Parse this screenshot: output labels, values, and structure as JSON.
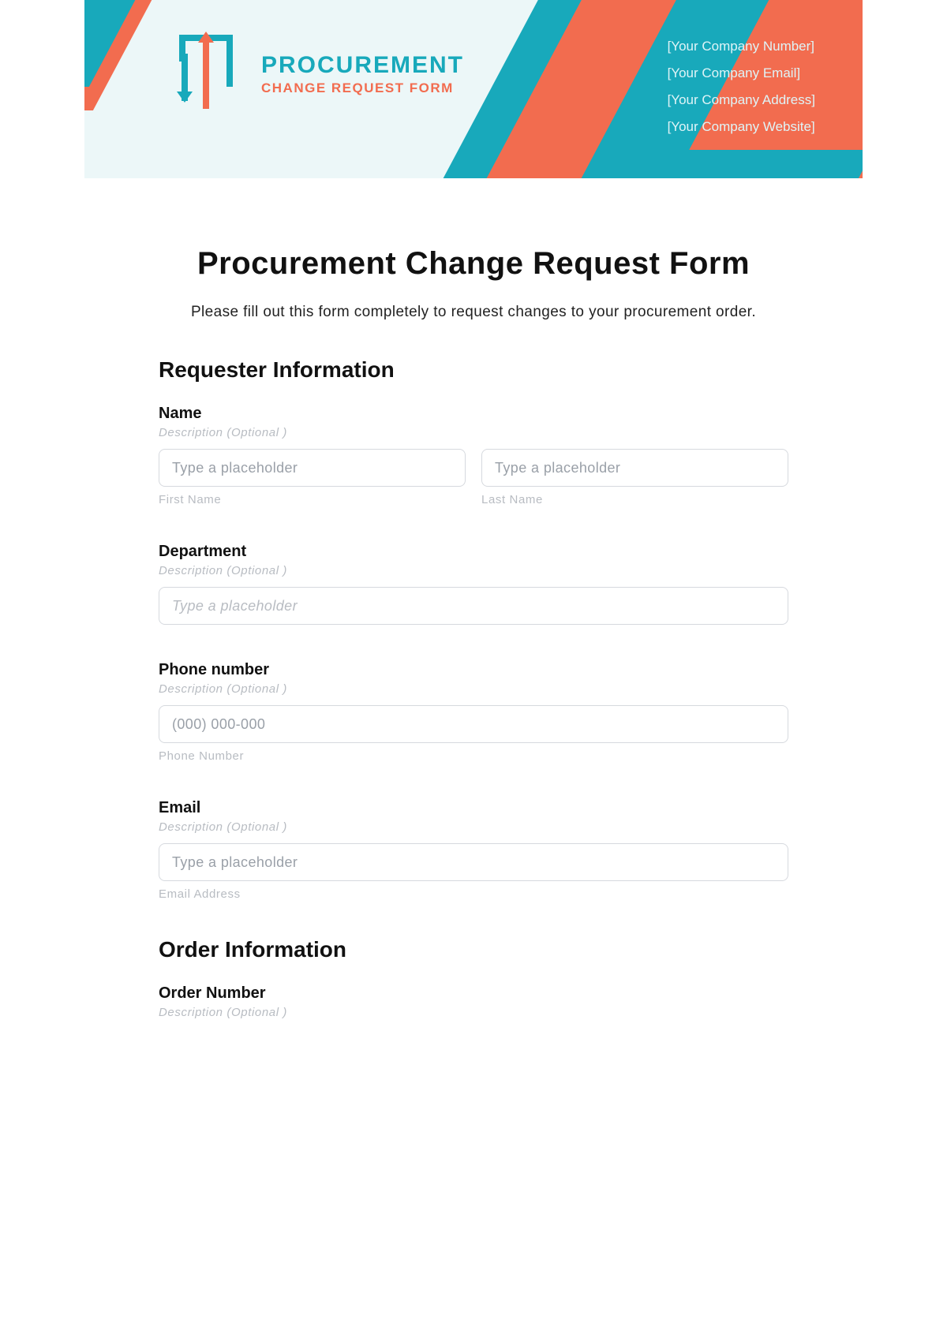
{
  "header": {
    "brand_line1": "PROCUREMENT",
    "brand_line2": "CHANGE REQUEST FORM",
    "company_info": [
      "[Your Company Number]",
      "[Your Company Email]",
      "[Your Company Address]",
      "[Your Company Website]"
    ]
  },
  "page": {
    "title": "Procurement Change Request Form",
    "intro": "Please fill out this form completely to request changes to your procurement order."
  },
  "sections": {
    "requester": "Requester Information",
    "order": "Order Information"
  },
  "fields": {
    "name": {
      "label": "Name",
      "desc": "Description (Optional )",
      "first_placeholder": "Type a placeholder",
      "last_placeholder": "Type a placeholder",
      "first_sub": "First Name",
      "last_sub": "Last Name"
    },
    "department": {
      "label": "Department",
      "desc": "Description (Optional )",
      "placeholder": "Type a placeholder"
    },
    "phone": {
      "label": "Phone number",
      "desc": "Description (Optional )",
      "placeholder": "(000) 000-000",
      "sub": "Phone Number"
    },
    "email": {
      "label": "Email",
      "desc": "Description (Optional )",
      "placeholder": "Type a placeholder",
      "sub": "Email Address"
    },
    "order_number": {
      "label": "Order Number",
      "desc": "Description (Optional )"
    }
  }
}
